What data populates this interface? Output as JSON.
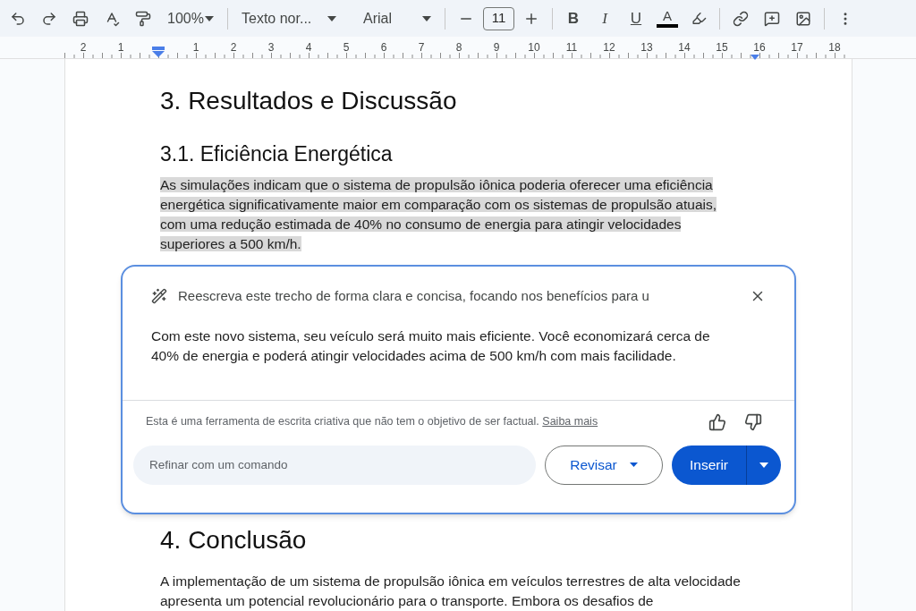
{
  "toolbar": {
    "zoom": "100%",
    "style": "Texto nor...",
    "font": "Arial",
    "font_size": "11",
    "format_buttons": [
      {
        "label": "B",
        "kind": "bold"
      },
      {
        "label": "I",
        "kind": "italic"
      },
      {
        "label": "U",
        "kind": "underline"
      },
      {
        "label": "A",
        "kind": "color"
      }
    ]
  },
  "ruler": {
    "left_labels": [
      "2",
      "1"
    ],
    "labels": [
      "1",
      "2",
      "3",
      "4",
      "5",
      "6",
      "7",
      "8",
      "9",
      "10",
      "11",
      "12",
      "13",
      "14",
      "15",
      "16",
      "17",
      "18"
    ]
  },
  "document": {
    "heading": "3. Resultados e Discussão",
    "subheading": "3.1. Eficiência Energética",
    "paragraph": {
      "text": "As simulações indicam que o sistema de propulsão iônica poderia oferecer uma eficiência energética significativamente maior em comparação com os sistemas de propulsão atuais, com uma redução estimada de 40% no consumo de energia para atingir velocidades superiores a 500 km/h.",
      "selected": true
    },
    "heading_2": "4. Conclusão",
    "paragraph_2": {
      "text": "A implementação de um sistema de propulsão iônica em veículos terrestres de alta velocidade apresenta um potencial revolucionário para o transporte. Embora os desafios de",
      "selected": false
    }
  },
  "assistant": {
    "prompt": "Reescreva este trecho de forma clara e concisa, focando nos benefícios para u",
    "response": "Com este novo sistema, seu veículo será muito mais eficiente. Você economizará cerca de 40% de energia e poderá atingir velocidades acima de 500 km/h com mais facilidade.",
    "disclaimer": "Esta é uma ferramenta de escrita criativa que não tem o objetivo de ser factual.",
    "link": "Saiba mais",
    "refine": {
      "placeholder": "Refinar com um comando"
    },
    "revise_button": "Revisar",
    "insert_button": "Inserir"
  }
}
